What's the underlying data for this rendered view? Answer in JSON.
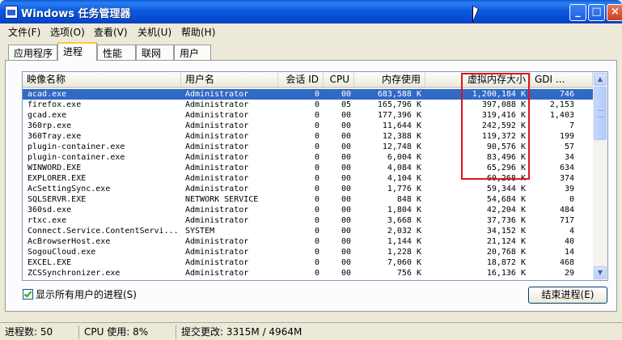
{
  "window": {
    "title": "Windows 任务管理器"
  },
  "menu": [
    "文件(F)",
    "选项(O)",
    "查看(V)",
    "关机(U)",
    "帮助(H)"
  ],
  "tabs": [
    "应用程序",
    "进程",
    "性能",
    "联网",
    "用户"
  ],
  "active_tab": "进程",
  "columns": {
    "name": "映像名称",
    "user": "用户名",
    "session": "会话 ID",
    "cpu": "CPU",
    "mem": "内存使用",
    "vmem": "虚拟内存大小",
    "gdi": "GDI ..."
  },
  "processes": [
    {
      "name": "acad.exe",
      "user": "Administrator",
      "session": "0",
      "cpu": "00",
      "mem": "683,588 K",
      "vmem": "1,200,184 K",
      "gdi": "746"
    },
    {
      "name": "firefox.exe",
      "user": "Administrator",
      "session": "0",
      "cpu": "05",
      "mem": "165,796 K",
      "vmem": "397,088 K",
      "gdi": "2,153"
    },
    {
      "name": "gcad.exe",
      "user": "Administrator",
      "session": "0",
      "cpu": "00",
      "mem": "177,396 K",
      "vmem": "319,416 K",
      "gdi": "1,403"
    },
    {
      "name": "360rp.exe",
      "user": "Administrator",
      "session": "0",
      "cpu": "00",
      "mem": "11,644 K",
      "vmem": "242,592 K",
      "gdi": "7"
    },
    {
      "name": "360Tray.exe",
      "user": "Administrator",
      "session": "0",
      "cpu": "00",
      "mem": "12,388 K",
      "vmem": "119,372 K",
      "gdi": "199"
    },
    {
      "name": "plugin-container.exe",
      "user": "Administrator",
      "session": "0",
      "cpu": "00",
      "mem": "12,748 K",
      "vmem": "90,576 K",
      "gdi": "57"
    },
    {
      "name": "plugin-container.exe",
      "user": "Administrator",
      "session": "0",
      "cpu": "00",
      "mem": "6,004 K",
      "vmem": "83,496 K",
      "gdi": "34"
    },
    {
      "name": "WINWORD.EXE",
      "user": "Administrator",
      "session": "0",
      "cpu": "00",
      "mem": "4,084 K",
      "vmem": "65,296 K",
      "gdi": "634"
    },
    {
      "name": "EXPLORER.EXE",
      "user": "Administrator",
      "session": "0",
      "cpu": "00",
      "mem": "4,104 K",
      "vmem": "60,268 K",
      "gdi": "374"
    },
    {
      "name": "AcSettingSync.exe",
      "user": "Administrator",
      "session": "0",
      "cpu": "00",
      "mem": "1,776 K",
      "vmem": "59,344 K",
      "gdi": "39"
    },
    {
      "name": "SQLSERVR.EXE",
      "user": "NETWORK SERVICE",
      "session": "0",
      "cpu": "00",
      "mem": "848 K",
      "vmem": "54,684 K",
      "gdi": "0"
    },
    {
      "name": "360sd.exe",
      "user": "Administrator",
      "session": "0",
      "cpu": "00",
      "mem": "1,804 K",
      "vmem": "42,204 K",
      "gdi": "484"
    },
    {
      "name": "rtxc.exe",
      "user": "Administrator",
      "session": "0",
      "cpu": "00",
      "mem": "3,668 K",
      "vmem": "37,736 K",
      "gdi": "717"
    },
    {
      "name": "Connect.Service.ContentServi...",
      "user": "SYSTEM",
      "session": "0",
      "cpu": "00",
      "mem": "2,032 K",
      "vmem": "34,152 K",
      "gdi": "4"
    },
    {
      "name": "AcBrowserHost.exe",
      "user": "Administrator",
      "session": "0",
      "cpu": "00",
      "mem": "1,144 K",
      "vmem": "21,124 K",
      "gdi": "40"
    },
    {
      "name": "SogouCloud.exe",
      "user": "Administrator",
      "session": "0",
      "cpu": "00",
      "mem": "1,228 K",
      "vmem": "20,768 K",
      "gdi": "14"
    },
    {
      "name": "EXCEL.EXE",
      "user": "Administrator",
      "session": "0",
      "cpu": "00",
      "mem": "7,060 K",
      "vmem": "18,872 K",
      "gdi": "468"
    },
    {
      "name": "ZCSSynchronizer.exe",
      "user": "Administrator",
      "session": "0",
      "cpu": "00",
      "mem": "756 K",
      "vmem": "16,136 K",
      "gdi": "29"
    }
  ],
  "show_all_users": {
    "label": "显示所有用户的进程(S)",
    "checked": true
  },
  "end_process_button": "结束进程(E)",
  "status": {
    "processes": "进程数: 50",
    "cpu": "CPU 使用: 8%",
    "commit": "提交更改: 3315M / 4964M"
  }
}
